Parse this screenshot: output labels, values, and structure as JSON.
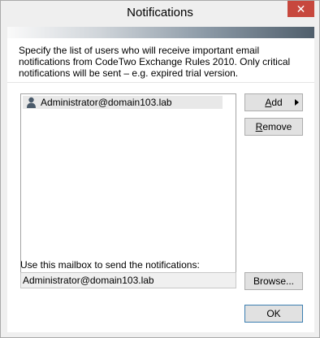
{
  "window": {
    "title": "Notifications",
    "close_glyph": "✕"
  },
  "description": "Specify the list of users who will receive important email notifications from CodeTwo Exchange Rules 2010. Only critical notifications will be sent – e.g. expired trial version.",
  "recipients": {
    "items": [
      {
        "label": "Administrator@domain103.lab",
        "icon": "user-icon"
      }
    ]
  },
  "buttons": {
    "add_label_rest": "dd",
    "add_label_key": "A",
    "remove_label_key": "R",
    "remove_label_rest": "emove",
    "browse_label": "Browse...",
    "ok_label": "OK"
  },
  "mailbox": {
    "label": "Use this mailbox to send the notifications:",
    "value": "Administrator@domain103.lab"
  },
  "colors": {
    "close_button": "#c7483e",
    "banner_dark": "#4f5e6b"
  }
}
